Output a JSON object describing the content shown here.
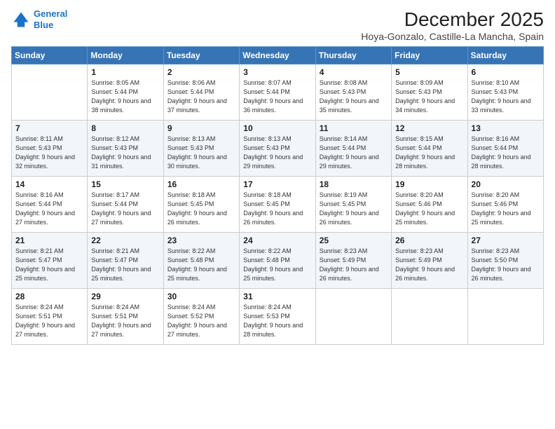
{
  "logo": {
    "line1": "General",
    "line2": "Blue"
  },
  "title": "December 2025",
  "subtitle": "Hoya-Gonzalo, Castille-La Mancha, Spain",
  "weekdays": [
    "Sunday",
    "Monday",
    "Tuesday",
    "Wednesday",
    "Thursday",
    "Friday",
    "Saturday"
  ],
  "weeks": [
    [
      {
        "day": "",
        "sunrise": "",
        "sunset": "",
        "daylight": ""
      },
      {
        "day": "1",
        "sunrise": "Sunrise: 8:05 AM",
        "sunset": "Sunset: 5:44 PM",
        "daylight": "Daylight: 9 hours and 38 minutes."
      },
      {
        "day": "2",
        "sunrise": "Sunrise: 8:06 AM",
        "sunset": "Sunset: 5:44 PM",
        "daylight": "Daylight: 9 hours and 37 minutes."
      },
      {
        "day": "3",
        "sunrise": "Sunrise: 8:07 AM",
        "sunset": "Sunset: 5:44 PM",
        "daylight": "Daylight: 9 hours and 36 minutes."
      },
      {
        "day": "4",
        "sunrise": "Sunrise: 8:08 AM",
        "sunset": "Sunset: 5:43 PM",
        "daylight": "Daylight: 9 hours and 35 minutes."
      },
      {
        "day": "5",
        "sunrise": "Sunrise: 8:09 AM",
        "sunset": "Sunset: 5:43 PM",
        "daylight": "Daylight: 9 hours and 34 minutes."
      },
      {
        "day": "6",
        "sunrise": "Sunrise: 8:10 AM",
        "sunset": "Sunset: 5:43 PM",
        "daylight": "Daylight: 9 hours and 33 minutes."
      }
    ],
    [
      {
        "day": "7",
        "sunrise": "Sunrise: 8:11 AM",
        "sunset": "Sunset: 5:43 PM",
        "daylight": "Daylight: 9 hours and 32 minutes."
      },
      {
        "day": "8",
        "sunrise": "Sunrise: 8:12 AM",
        "sunset": "Sunset: 5:43 PM",
        "daylight": "Daylight: 9 hours and 31 minutes."
      },
      {
        "day": "9",
        "sunrise": "Sunrise: 8:13 AM",
        "sunset": "Sunset: 5:43 PM",
        "daylight": "Daylight: 9 hours and 30 minutes."
      },
      {
        "day": "10",
        "sunrise": "Sunrise: 8:13 AM",
        "sunset": "Sunset: 5:43 PM",
        "daylight": "Daylight: 9 hours and 29 minutes."
      },
      {
        "day": "11",
        "sunrise": "Sunrise: 8:14 AM",
        "sunset": "Sunset: 5:44 PM",
        "daylight": "Daylight: 9 hours and 29 minutes."
      },
      {
        "day": "12",
        "sunrise": "Sunrise: 8:15 AM",
        "sunset": "Sunset: 5:44 PM",
        "daylight": "Daylight: 9 hours and 28 minutes."
      },
      {
        "day": "13",
        "sunrise": "Sunrise: 8:16 AM",
        "sunset": "Sunset: 5:44 PM",
        "daylight": "Daylight: 9 hours and 28 minutes."
      }
    ],
    [
      {
        "day": "14",
        "sunrise": "Sunrise: 8:16 AM",
        "sunset": "Sunset: 5:44 PM",
        "daylight": "Daylight: 9 hours and 27 minutes."
      },
      {
        "day": "15",
        "sunrise": "Sunrise: 8:17 AM",
        "sunset": "Sunset: 5:44 PM",
        "daylight": "Daylight: 9 hours and 27 minutes."
      },
      {
        "day": "16",
        "sunrise": "Sunrise: 8:18 AM",
        "sunset": "Sunset: 5:45 PM",
        "daylight": "Daylight: 9 hours and 26 minutes."
      },
      {
        "day": "17",
        "sunrise": "Sunrise: 8:18 AM",
        "sunset": "Sunset: 5:45 PM",
        "daylight": "Daylight: 9 hours and 26 minutes."
      },
      {
        "day": "18",
        "sunrise": "Sunrise: 8:19 AM",
        "sunset": "Sunset: 5:45 PM",
        "daylight": "Daylight: 9 hours and 26 minutes."
      },
      {
        "day": "19",
        "sunrise": "Sunrise: 8:20 AM",
        "sunset": "Sunset: 5:46 PM",
        "daylight": "Daylight: 9 hours and 25 minutes."
      },
      {
        "day": "20",
        "sunrise": "Sunrise: 8:20 AM",
        "sunset": "Sunset: 5:46 PM",
        "daylight": "Daylight: 9 hours and 25 minutes."
      }
    ],
    [
      {
        "day": "21",
        "sunrise": "Sunrise: 8:21 AM",
        "sunset": "Sunset: 5:47 PM",
        "daylight": "Daylight: 9 hours and 25 minutes."
      },
      {
        "day": "22",
        "sunrise": "Sunrise: 8:21 AM",
        "sunset": "Sunset: 5:47 PM",
        "daylight": "Daylight: 9 hours and 25 minutes."
      },
      {
        "day": "23",
        "sunrise": "Sunrise: 8:22 AM",
        "sunset": "Sunset: 5:48 PM",
        "daylight": "Daylight: 9 hours and 25 minutes."
      },
      {
        "day": "24",
        "sunrise": "Sunrise: 8:22 AM",
        "sunset": "Sunset: 5:48 PM",
        "daylight": "Daylight: 9 hours and 25 minutes."
      },
      {
        "day": "25",
        "sunrise": "Sunrise: 8:23 AM",
        "sunset": "Sunset: 5:49 PM",
        "daylight": "Daylight: 9 hours and 26 minutes."
      },
      {
        "day": "26",
        "sunrise": "Sunrise: 8:23 AM",
        "sunset": "Sunset: 5:49 PM",
        "daylight": "Daylight: 9 hours and 26 minutes."
      },
      {
        "day": "27",
        "sunrise": "Sunrise: 8:23 AM",
        "sunset": "Sunset: 5:50 PM",
        "daylight": "Daylight: 9 hours and 26 minutes."
      }
    ],
    [
      {
        "day": "28",
        "sunrise": "Sunrise: 8:24 AM",
        "sunset": "Sunset: 5:51 PM",
        "daylight": "Daylight: 9 hours and 27 minutes."
      },
      {
        "day": "29",
        "sunrise": "Sunrise: 8:24 AM",
        "sunset": "Sunset: 5:51 PM",
        "daylight": "Daylight: 9 hours and 27 minutes."
      },
      {
        "day": "30",
        "sunrise": "Sunrise: 8:24 AM",
        "sunset": "Sunset: 5:52 PM",
        "daylight": "Daylight: 9 hours and 27 minutes."
      },
      {
        "day": "31",
        "sunrise": "Sunrise: 8:24 AM",
        "sunset": "Sunset: 5:53 PM",
        "daylight": "Daylight: 9 hours and 28 minutes."
      },
      {
        "day": "",
        "sunrise": "",
        "sunset": "",
        "daylight": ""
      },
      {
        "day": "",
        "sunrise": "",
        "sunset": "",
        "daylight": ""
      },
      {
        "day": "",
        "sunrise": "",
        "sunset": "",
        "daylight": ""
      }
    ]
  ]
}
